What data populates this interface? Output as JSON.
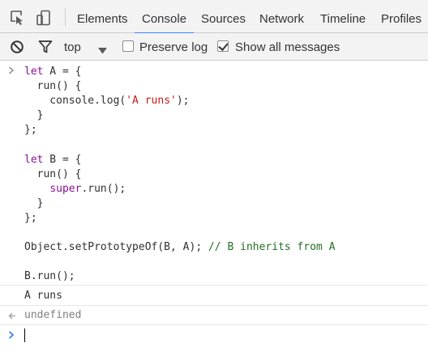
{
  "tabs": [
    {
      "label": "Elements"
    },
    {
      "label": "Console",
      "active": true
    },
    {
      "label": "Sources"
    },
    {
      "label": "Network"
    },
    {
      "label": "Timeline"
    },
    {
      "label": "Profiles"
    }
  ],
  "toolbar": {
    "context_label": "top",
    "preserve_log_label": "Preserve log",
    "preserve_log_checked": false,
    "show_all_label": "Show all messages",
    "show_all_checked": true
  },
  "console": {
    "input_lines": [
      {
        "parts": [
          {
            "t": "let",
            "c": "kw"
          },
          {
            "t": " A = {",
            "c": ""
          }
        ]
      },
      {
        "parts": [
          {
            "t": "  run() {",
            "c": ""
          }
        ]
      },
      {
        "parts": [
          {
            "t": "    console.log(",
            "c": ""
          },
          {
            "t": "'A runs'",
            "c": "str"
          },
          {
            "t": ");",
            "c": ""
          }
        ]
      },
      {
        "parts": [
          {
            "t": "  }",
            "c": ""
          }
        ]
      },
      {
        "parts": [
          {
            "t": "};",
            "c": ""
          }
        ]
      },
      {
        "parts": []
      },
      {
        "parts": [
          {
            "t": "let",
            "c": "kw"
          },
          {
            "t": " B = {",
            "c": ""
          }
        ]
      },
      {
        "parts": [
          {
            "t": "  run() {",
            "c": ""
          }
        ]
      },
      {
        "parts": [
          {
            "t": "    ",
            "c": ""
          },
          {
            "t": "super",
            "c": "kw"
          },
          {
            "t": ".run();",
            "c": ""
          }
        ]
      },
      {
        "parts": [
          {
            "t": "  }",
            "c": ""
          }
        ]
      },
      {
        "parts": [
          {
            "t": "};",
            "c": ""
          }
        ]
      },
      {
        "parts": []
      },
      {
        "parts": [
          {
            "t": "Object.setPrototypeOf(B, A); ",
            "c": ""
          },
          {
            "t": "// B inherits from A",
            "c": "cmt"
          }
        ]
      },
      {
        "parts": []
      },
      {
        "parts": [
          {
            "t": "B.run();",
            "c": ""
          }
        ]
      }
    ],
    "log_output": "A runs",
    "return_value": "undefined"
  },
  "icons": {
    "inspect": "inspect-element-icon",
    "device": "device-mode-icon",
    "clear": "clear-console-icon",
    "filter": "filter-icon"
  },
  "colors": {
    "keyword": "#881391",
    "string": "#c41a16",
    "comment": "#236e25",
    "active_tab_underline": "#3e82f7",
    "prompt_chevron": "#3e82f7"
  }
}
